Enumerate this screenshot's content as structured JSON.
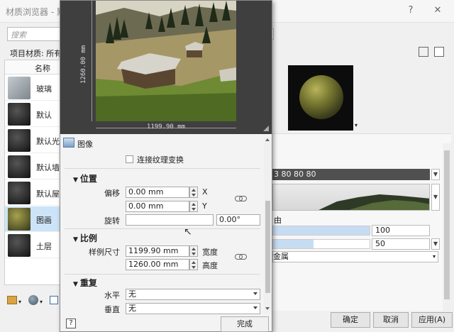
{
  "window": {
    "title": "材质浏览器 - 默",
    "help": "?",
    "close": "✕"
  },
  "search": {
    "placeholder": "搜索"
  },
  "project": {
    "label": "项目材质: 所有"
  },
  "list": {
    "header": "名称",
    "items": [
      {
        "label": "玻璃",
        "thumb": "#9aa4aa"
      },
      {
        "label": "默认",
        "thumb": "#2a2a2a"
      },
      {
        "label": "默认光",
        "thumb": "#2a2a2a"
      },
      {
        "label": "默认墙",
        "thumb": "#2a2a2a"
      },
      {
        "label": "默认屋",
        "thumb": "#2a2a2a"
      },
      {
        "label": "图画",
        "thumb": "#5b5e2c"
      },
      {
        "label": "土层",
        "thumb": "#2a2a2a"
      }
    ]
  },
  "right": {
    "color_value": "3 80 80 80",
    "slider1_value": "100",
    "slider2_value": "50",
    "select_value": "金属",
    "section_label": "由"
  },
  "buttons": {
    "ok": "确定",
    "cancel": "取消",
    "apply": "应用(A)"
  },
  "editor": {
    "dim_width": "1199.90 mm",
    "dim_height": "1260.00 mm",
    "image_label": "图像",
    "link_texture": "连接纹理变换",
    "position": {
      "title": "位置",
      "offset_label": "偏移",
      "offset_x": "0.00 mm",
      "offset_y": "0.00 mm",
      "x": "X",
      "y": "Y",
      "rotate_label": "旋转",
      "rotate_value": "0.00°"
    },
    "scale": {
      "title": "比例",
      "size_label": "样例尺寸",
      "width": "1199.90 mm",
      "height": "1260.00 mm",
      "width_label": "宽度",
      "height_label": "高度"
    },
    "repeat": {
      "title": "重复",
      "horizontal_label": "水平",
      "horizontal_value": "无",
      "vertical_label": "垂直",
      "vertical_value": "无"
    },
    "help": "?",
    "done": "完成"
  }
}
